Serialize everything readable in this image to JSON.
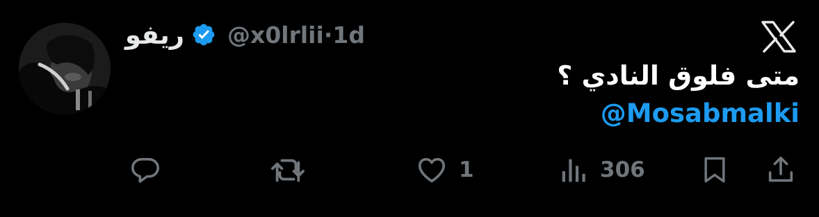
{
  "author": {
    "display_name": "ريفو",
    "handle": "@x0lrlii",
    "separator": "·",
    "time_ago": "1d",
    "verified": true
  },
  "tweet": {
    "text": "متى فلوق النادي ؟",
    "mention": "@Mosabmalki"
  },
  "actions": {
    "reply": {
      "icon": "reply-icon",
      "count": ""
    },
    "retweet": {
      "icon": "retweet-icon",
      "count": ""
    },
    "like": {
      "icon": "heart-icon",
      "count": "1"
    },
    "views": {
      "icon": "views-icon",
      "count": "306"
    },
    "bookmark": {
      "icon": "bookmark-icon"
    },
    "share": {
      "icon": "share-icon"
    }
  },
  "colors": {
    "background": "#000000",
    "text": "#e7e9ea",
    "muted": "#71767b",
    "accent": "#1d9bf0"
  }
}
